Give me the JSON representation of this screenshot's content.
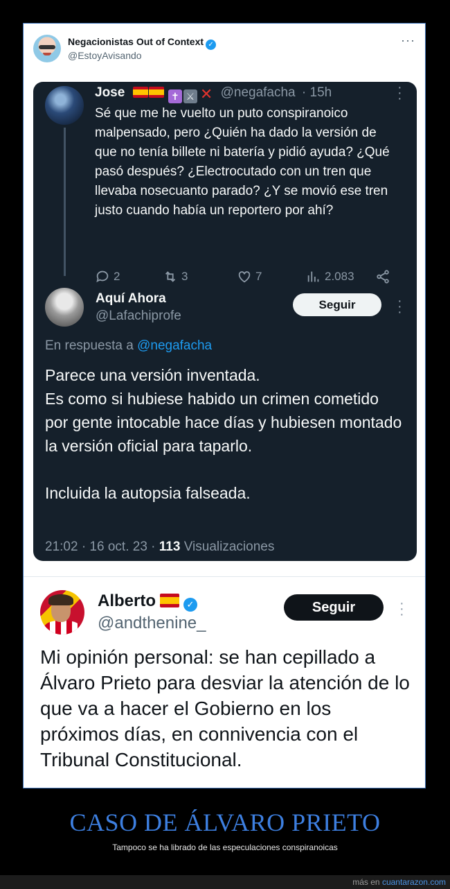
{
  "top_tweet": {
    "name": "Negacionistas Out of Context",
    "handle": "@EstoyAvisando",
    "more": "···"
  },
  "jose_tweet": {
    "name": "Jose",
    "handle": "@negafacha",
    "time": "· 15h",
    "text": "Sé que me he vuelto un puto conspiranoico malpensado, pero ¿Quién ha dado la versión de que no tenía billete ni batería y pidió ayuda? ¿Qué pasó después? ¿Electrocutado con un tren que llevaba nosecuanto parado? ¿Y se movió ese tren justo cuando había un reportero por ahí?",
    "replies": "2",
    "retweets": "3",
    "likes": "7",
    "views": "2.083"
  },
  "aqui_tweet": {
    "name": "Aquí Ahora",
    "handle": "@Lafachiprofe",
    "follow_label": "Seguir",
    "reply_prefix": "En respuesta a",
    "reply_mention": "@negafacha",
    "text_p1": "Parece una versión inventada.",
    "text_p2": "Es como si hubiese habido un crimen cometido por gente intocable hace días y hubiesen montado la versión oficial para taparlo.",
    "text_p3": "Incluida la autopsia falseada.",
    "timestamp": "21:02 · 16 oct. 23 ·",
    "views_count": "113",
    "views_label": "Visualizaciones"
  },
  "alberto_tweet": {
    "name": "Alberto",
    "handle": "@andthenine_",
    "follow_label": "Seguir",
    "text": "Mi opinión personal: se han cepillado a Álvaro Prieto para desviar la atención de lo que va a hacer el Gobierno en los próximos días, en connivencia con el Tribunal Constitucional."
  },
  "caption": {
    "title": "CASO DE ÁLVARO PRIETO",
    "subtitle": "Tampoco se ha librado de las especulaciones conspiranoicas"
  },
  "footer": {
    "prefix": "más en",
    "link": "cuantarazon.com"
  },
  "colors": {
    "accent": "#1d9bf0",
    "dark_bg": "#15202b",
    "caption_blue": "#3d7fe0"
  }
}
